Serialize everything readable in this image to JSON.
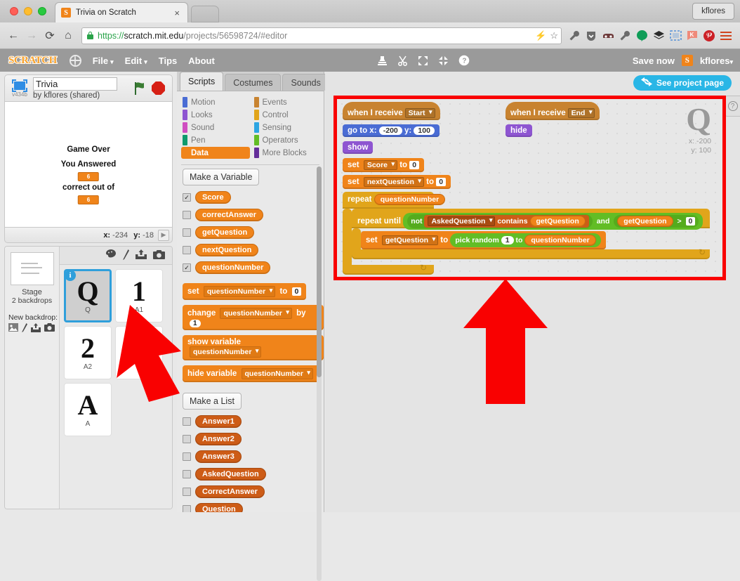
{
  "browser": {
    "tab_title": "Trivia on Scratch",
    "tab_favicon": "S",
    "tab_close": "×",
    "profile_name": "kflores",
    "back_icon": "←",
    "forward_icon": "→",
    "reload_icon": "⟳",
    "home_icon": "⌂",
    "url_scheme": "https://",
    "url_host": "scratch.mit.edu",
    "url_path": "/projects/56598724/#editor",
    "omni_bolt": "⚡",
    "omni_star": "☆",
    "extensions": [
      "wrench-icon",
      "shield-icon",
      "mask-icon",
      "wrench2-icon",
      "hangouts-icon",
      "layers-icon",
      "screenshot-icon",
      "k-icon",
      "pinterest-icon",
      "menu-icon"
    ]
  },
  "scratch_menu": {
    "logo": "SCRATCH",
    "globe": "globe-icon",
    "items": [
      "File",
      "Edit",
      "Tips",
      "About"
    ],
    "file_caret": "▾",
    "edit_caret": "▾",
    "tools": [
      "stamp-icon",
      "scissors-icon",
      "grow-icon",
      "shrink-icon",
      "help-icon"
    ],
    "save_now": "Save now",
    "user_badge": "S",
    "user_name": "kflores",
    "user_caret": "▾"
  },
  "stage": {
    "version": "v434b",
    "project_title": "Trivia",
    "author": "by kflores (shared)",
    "green_flag": "green-flag-icon",
    "stop": "stop-icon",
    "content": {
      "line1": "Game Over",
      "line2": "You Answered",
      "var1": "6",
      "line3": "correct out of",
      "var2": "6"
    },
    "coords_x_label": "x:",
    "coords_x": "-234",
    "coords_y_label": "y:",
    "coords_y": "-18",
    "collapse": "▶"
  },
  "sprite_pane": {
    "toolbar_icons": [
      "paint-new-sprite-icon",
      "choose-sprite-icon",
      "upload-sprite-icon",
      "camera-sprite-icon"
    ],
    "stage_label": "Stage",
    "stage_sub": "2 backdrops",
    "new_backdrop_label": "New backdrop:",
    "new_backdrop_icons": [
      "choose-backdrop-icon",
      "paint-backdrop-icon",
      "upload-backdrop-icon",
      "camera-backdrop-icon"
    ],
    "sprites": [
      {
        "glyph": "Q",
        "name": "Q",
        "selected": true,
        "info": "i"
      },
      {
        "glyph": "1",
        "name": "A1",
        "selected": false
      },
      {
        "glyph": "2",
        "name": "A2",
        "selected": false
      },
      {
        "glyph": "",
        "name": "",
        "selected": false
      },
      {
        "glyph": "A",
        "name": "A",
        "selected": false
      }
    ]
  },
  "palette": {
    "tabs": [
      {
        "label": "Scripts",
        "active": true
      },
      {
        "label": "Costumes",
        "active": false
      },
      {
        "label": "Sounds",
        "active": false
      }
    ],
    "categories_left": [
      {
        "label": "Motion",
        "color": "#4a6cd4",
        "active": false
      },
      {
        "label": "Looks",
        "color": "#8e55d1",
        "active": false
      },
      {
        "label": "Sound",
        "color": "#cf4ec1",
        "active": false
      },
      {
        "label": "Pen",
        "color": "#0e9a6c",
        "active": false
      },
      {
        "label": "Data",
        "color": "#f0841a",
        "active": true
      }
    ],
    "categories_right": [
      {
        "label": "Events",
        "color": "#c88330",
        "active": false
      },
      {
        "label": "Control",
        "color": "#e1a51b",
        "active": false
      },
      {
        "label": "Sensing",
        "color": "#2ca5e2",
        "active": false
      },
      {
        "label": "Operators",
        "color": "#62bd25",
        "active": false
      },
      {
        "label": "More Blocks",
        "color": "#632d99",
        "active": false
      }
    ],
    "make_variable": "Make a Variable",
    "variables": [
      {
        "name": "Score",
        "checked": true
      },
      {
        "name": "correctAnswer",
        "checked": false
      },
      {
        "name": "getQuestion",
        "checked": false
      },
      {
        "name": "nextQuestion",
        "checked": false
      },
      {
        "name": "questionNumber",
        "checked": true
      }
    ],
    "blocks": [
      {
        "op": "set",
        "var": "questionNumber",
        "mid": "to",
        "val": "0",
        "type": "num"
      },
      {
        "op": "change",
        "var": "questionNumber",
        "mid": "by",
        "val": "1",
        "type": "round"
      },
      {
        "op": "show variable",
        "var": "questionNumber",
        "mid": "",
        "val": "",
        "type": "none"
      },
      {
        "op": "hide variable",
        "var": "questionNumber",
        "mid": "",
        "val": "",
        "type": "none"
      }
    ],
    "make_list": "Make a List",
    "lists": [
      {
        "name": "Answer1",
        "checked": false
      },
      {
        "name": "Answer2",
        "checked": false
      },
      {
        "name": "Answer3",
        "checked": false
      },
      {
        "name": "AskedQuestion",
        "checked": false
      },
      {
        "name": "CorrectAnswer",
        "checked": false
      },
      {
        "name": "Question",
        "checked": false
      }
    ]
  },
  "scripts": {
    "see_project_page": "See project page",
    "see_project_icon": "refresh-icon",
    "help_icon": "?",
    "watermark_glyph": "Q",
    "watermark_x_label": "x:",
    "watermark_x": "-200",
    "watermark_y_label": "y:",
    "watermark_y": "100",
    "script1": {
      "hat": {
        "text1": "when  I  receive",
        "dropdown": "Start"
      },
      "goto": {
        "label1": "go  to  x:",
        "x": "-200",
        "label2": "y:",
        "y": "100"
      },
      "show": "show",
      "set_score": {
        "op": "set",
        "var": "Score",
        "mid": "to",
        "val": "0"
      },
      "set_next": {
        "op": "set",
        "var": "nextQuestion",
        "mid": "to",
        "val": "0"
      },
      "repeat": {
        "label": "repeat",
        "count": "questionNumber"
      },
      "repeat_until": {
        "label": "repeat  until",
        "not": "not",
        "list": "AskedQuestion",
        "contains": "contains",
        "operand1": "getQuestion",
        "and": "and",
        "operand2": "getQuestion",
        "gt": ">",
        "gt_value": "0"
      },
      "set_get": {
        "op": "set",
        "var": "getQuestion",
        "mid": "to",
        "random_label": "pick  random",
        "from": "1",
        "to_label": "to",
        "to_value": "questionNumber"
      }
    },
    "script2": {
      "hat": {
        "text1": "when  I  receive",
        "dropdown": "End"
      },
      "hide": "hide"
    }
  },
  "annotations": {
    "highlight_color": "#f90101",
    "arrow_color": "#f90101",
    "arrow1_name": "red-arrow-pointing-to-sprite",
    "arrow2_name": "red-arrow-pointing-to-scripts"
  }
}
